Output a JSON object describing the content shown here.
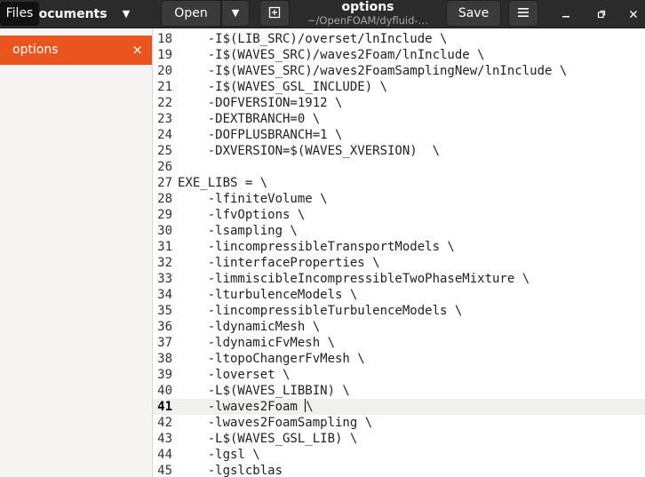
{
  "header": {
    "files_label": "Files",
    "documents_label": "Documents",
    "documents_arrow": "▼",
    "open_label": "Open",
    "open_arrow": "▼",
    "title": "options",
    "subtitle": "~/OpenFOAM/dyfluid-…",
    "save_label": "Save"
  },
  "sidebar": {
    "documents": [
      {
        "label": "options",
        "close": "×"
      }
    ]
  },
  "editor": {
    "current_line": 41,
    "lines": [
      {
        "n": "18",
        "text": "    -I$(LIB_SRC)/overset/lnInclude \\"
      },
      {
        "n": "19",
        "text": "    -I$(WAVES_SRC)/waves2Foam/lnInclude \\"
      },
      {
        "n": "20",
        "text": "    -I$(WAVES_SRC)/waves2FoamSamplingNew/lnInclude \\"
      },
      {
        "n": "21",
        "text": "    -I$(WAVES_GSL_INCLUDE) \\"
      },
      {
        "n": "22",
        "text": "    -DOFVERSION=1912 \\"
      },
      {
        "n": "23",
        "text": "    -DEXTBRANCH=0 \\"
      },
      {
        "n": "24",
        "text": "    -DOFPLUSBRANCH=1 \\"
      },
      {
        "n": "25",
        "text": "    -DXVERSION=$(WAVES_XVERSION)  \\"
      },
      {
        "n": "26",
        "text": ""
      },
      {
        "n": "27",
        "text": "EXE_LIBS = \\"
      },
      {
        "n": "28",
        "text": "    -lfiniteVolume \\"
      },
      {
        "n": "29",
        "text": "    -lfvOptions \\"
      },
      {
        "n": "30",
        "text": "    -lsampling \\"
      },
      {
        "n": "31",
        "text": "    -lincompressibleTransportModels \\"
      },
      {
        "n": "32",
        "text": "    -linterfaceProperties \\"
      },
      {
        "n": "33",
        "text": "    -limmiscibleIncompressibleTwoPhaseMixture \\"
      },
      {
        "n": "34",
        "text": "    -lturbulenceModels \\"
      },
      {
        "n": "35",
        "text": "    -lincompressibleTurbulenceModels \\"
      },
      {
        "n": "36",
        "text": "    -ldynamicMesh \\"
      },
      {
        "n": "37",
        "text": "    -ldynamicFvMesh \\"
      },
      {
        "n": "38",
        "text": "    -ltopoChangerFvMesh \\"
      },
      {
        "n": "39",
        "text": "    -loverset \\"
      },
      {
        "n": "40",
        "text": "    -L$(WAVES_LIBBIN) \\"
      },
      {
        "n": "41",
        "text": "    -lwaves2Foam \\"
      },
      {
        "n": "42",
        "text": "    -lwaves2FoamSampling \\"
      },
      {
        "n": "43",
        "text": "    -L$(WAVES_GSL_LIB) \\"
      },
      {
        "n": "44",
        "text": "    -lgsl \\"
      },
      {
        "n": "45",
        "text": "    -lgslcblas"
      }
    ]
  }
}
